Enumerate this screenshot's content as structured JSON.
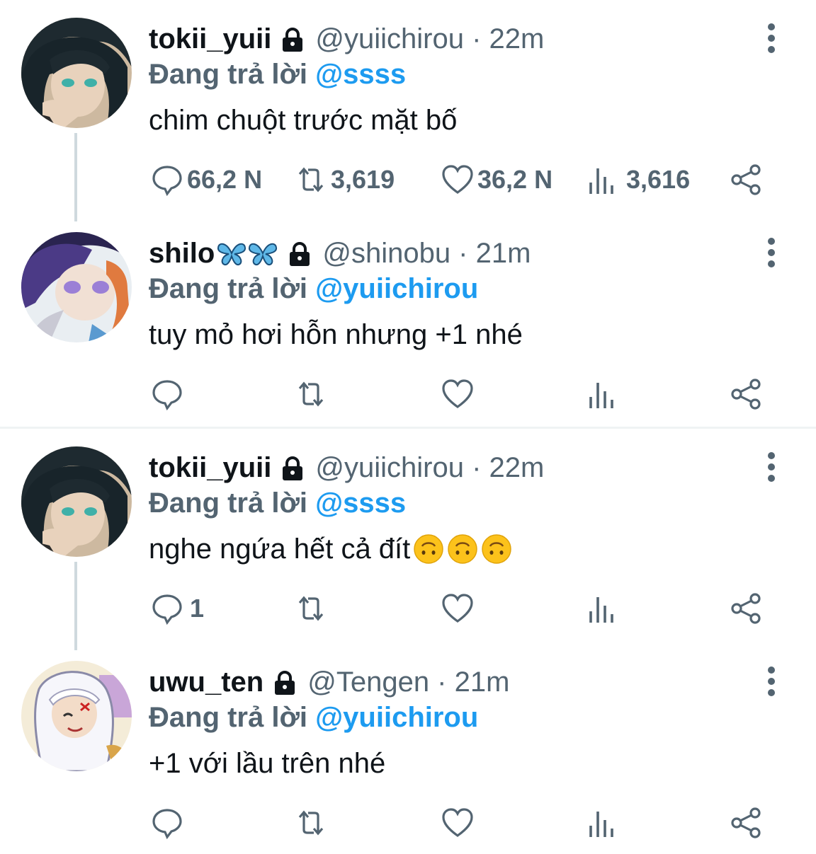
{
  "tweets": [
    {
      "name": "tokii_yuii",
      "handle": "@yuiichirou · 22m",
      "reply_prefix": "Đang trả lời",
      "reply_to": "@ssss",
      "text": "chim chuột trước mặt bố",
      "counts": {
        "reply": "66,2 N",
        "retweet": "3,619",
        "like": "36,2 N",
        "views": "3,616"
      },
      "avatar": "avatar-dark-hair-teal-eyes"
    },
    {
      "name": "shilo",
      "name_emoji": "butterfly-emoji x2",
      "handle": "@shinobu · 21m",
      "reply_prefix": "Đang trả lời",
      "reply_to": "@yuiichirou",
      "text": "tuy mỏ hơi hỗn nhưng +1 nhé",
      "counts": {
        "reply": "",
        "retweet": "",
        "like": "",
        "views": ""
      },
      "avatar": "avatar-purple-eyes"
    },
    {
      "name": "tokii_yuii",
      "handle": "@yuiichirou · 22m",
      "reply_prefix": "Đang trả lời",
      "reply_to": "@ssss",
      "text": "nghe ngứa hết cả đít",
      "text_emoji": "upside-down-face-emoji x3",
      "counts": {
        "reply": "1",
        "retweet": "",
        "like": "",
        "views": ""
      },
      "avatar": "avatar-dark-hair-teal-eyes"
    },
    {
      "name": "uwu_ten",
      "handle": "@Tengen · 21m",
      "reply_prefix": "Đang trả lời",
      "reply_to": "@yuiichirou",
      "text": "+1 với lầu trên nhé",
      "counts": {
        "reply": "",
        "retweet": "",
        "like": "",
        "views": ""
      },
      "avatar": "avatar-white-hood"
    }
  ],
  "colors": {
    "text": "#0f1419",
    "muted": "#536471",
    "link": "#1d9bf0",
    "line": "#cfd9de"
  },
  "icons": [
    "lock-icon",
    "more-vertical-icon",
    "reply-icon",
    "retweet-icon",
    "like-icon",
    "views-icon",
    "share-icon"
  ]
}
